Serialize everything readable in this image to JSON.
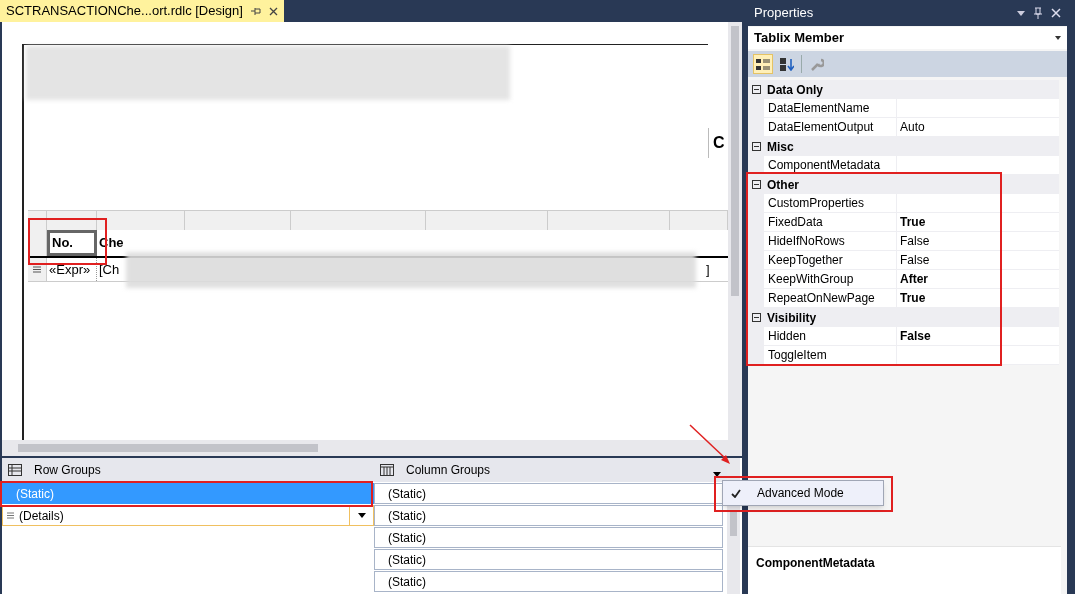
{
  "document_tab": {
    "title": "SCTRANSACTIONChe...ort.rdlc [Design]",
    "selected": true
  },
  "designer": {
    "side_label": "C",
    "header_cells": [
      {
        "text": "No.",
        "selected": true
      },
      {
        "text": "Che",
        "selected": false
      }
    ],
    "detail_cells": [
      "«Expr»",
      "[Ch",
      "]"
    ]
  },
  "row_groups": {
    "title": "Row Groups",
    "items": [
      {
        "label": "(Static)",
        "selected": true,
        "kind": "static"
      },
      {
        "label": "(Details)",
        "selected": false,
        "kind": "details"
      }
    ]
  },
  "column_groups": {
    "title": "Column Groups",
    "items": [
      {
        "label": "(Static)",
        "selected": false
      },
      {
        "label": "(Static)",
        "selected": false
      },
      {
        "label": "(Static)",
        "selected": false
      },
      {
        "label": "(Static)",
        "selected": false
      },
      {
        "label": "(Static)",
        "selected": false
      }
    ]
  },
  "context_menu": {
    "items": [
      {
        "label": "Advanced Mode",
        "checked": true
      }
    ]
  },
  "properties": {
    "title": "Properties",
    "object": "Tablix Member",
    "categorized": true,
    "categories": [
      {
        "name": "Data Only",
        "expanded": true,
        "properties": [
          {
            "name": "DataElementName"
          },
          {
            "name": "DataElementOutput",
            "value": "Auto",
            "modified": false
          }
        ]
      },
      {
        "name": "Misc",
        "expanded": true,
        "properties": [
          {
            "name": "ComponentMetadata"
          }
        ]
      },
      {
        "name": "Other",
        "expanded": true,
        "properties": [
          {
            "name": "CustomProperties"
          },
          {
            "name": "FixedData",
            "value": "True",
            "modified": true
          },
          {
            "name": "HideIfNoRows",
            "value": "False",
            "modified": false
          },
          {
            "name": "KeepTogether",
            "value": "False",
            "modified": false
          },
          {
            "name": "KeepWithGroup",
            "value": "After",
            "modified": true
          },
          {
            "name": "RepeatOnNewPage",
            "value": "True",
            "modified": true
          }
        ]
      },
      {
        "name": "Visibility",
        "expanded": true,
        "properties": [
          {
            "name": "Hidden",
            "value": "False",
            "modified": true
          },
          {
            "name": "ToggleItem"
          }
        ]
      }
    ],
    "description_title": "ComponentMetadata"
  }
}
